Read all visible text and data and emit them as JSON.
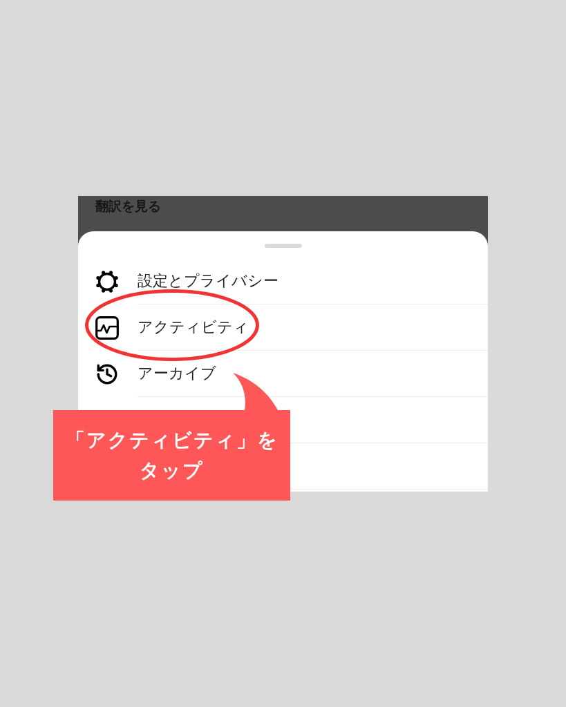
{
  "background": {
    "link_text": "翻訳を見る"
  },
  "sheet": {
    "items": [
      {
        "kind": "settings",
        "label": "設定とプライバシー",
        "highlighted": false
      },
      {
        "kind": "activity",
        "label": "アクティビティ",
        "highlighted": true
      },
      {
        "kind": "archive",
        "label": "アーカイブ",
        "highlighted": false
      }
    ]
  },
  "annotation": {
    "callout": "「アクティビティ」をタップ"
  }
}
